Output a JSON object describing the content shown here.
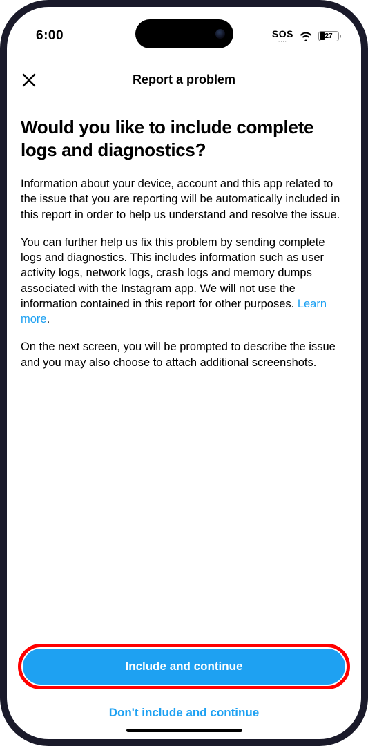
{
  "status_bar": {
    "time": "6:00",
    "sos": "SOS",
    "sos_dots": "....",
    "battery_percent": "27"
  },
  "nav": {
    "title": "Report a problem"
  },
  "content": {
    "heading": "Would you like to include complete logs and diagnostics?",
    "para1": "Information about your device, account and this app related to the issue that you are reporting will be automatically included in this report in order to help us understand and resolve the issue.",
    "para2_a": "You can further help us fix this problem by sending complete logs and diagnostics. This includes information such as user activity logs, network logs, crash logs and memory dumps associated with the Instagram app. We will not use the information contained in this report for other purposes. ",
    "learn_more": "Learn more",
    "para2_b": ".",
    "para3": "On the next screen, you will be prompted to describe the issue and you may also choose to attach additional screenshots."
  },
  "buttons": {
    "primary": "Include and continue",
    "secondary": "Don't include and continue"
  }
}
